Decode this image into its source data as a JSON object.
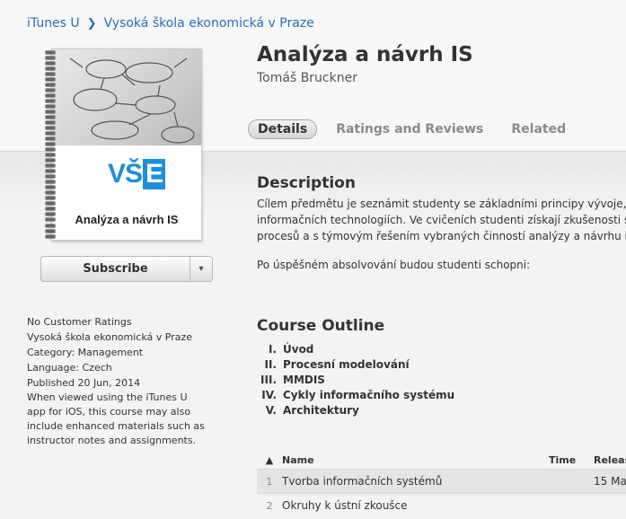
{
  "breadcrumb": {
    "items": [
      "iTunes U",
      "Vysoká škola ekonomická v Praze"
    ],
    "separator": "❯"
  },
  "artwork": {
    "logo_text": "VŠ",
    "logo_box": "E",
    "title": "Analýza a návrh IS"
  },
  "subscribe": {
    "label": "Subscribe",
    "dropdown_icon": "▾"
  },
  "side_info": {
    "ratings": "No Customer Ratings",
    "provider": "Vysoká škola ekonomická v Praze",
    "category": "Category: Management",
    "language": "Language: Czech",
    "published": "Published 20 Jun, 2014",
    "note": "When viewed using the iTunes U app for iOS, this course may also include enhanced materials such as instructor notes and assignments."
  },
  "course": {
    "title": "Analýza a návrh IS",
    "author": "Tomáš Bruckner"
  },
  "tabs": [
    "Details",
    "Ratings and Reviews",
    "Related"
  ],
  "description": {
    "heading": "Description",
    "line1": "Cílem předmětu je seznámit studenty se základními principy vývoje, pro",
    "line2": "informačních technologiích. Ve cvičeních studenti získají zkušenosti s mo",
    "line3": "procesů a s týmovým řešením vybraných činností analýzy a návrhu infor",
    "p2": "Po úspěšném absolvování budou studenti schopni:"
  },
  "outline": {
    "heading": "Course Outline",
    "items": [
      {
        "num": "I.",
        "label": "Úvod"
      },
      {
        "num": "II.",
        "label": "Procesní modelování"
      },
      {
        "num": "III.",
        "label": "MMDIS"
      },
      {
        "num": "IV.",
        "label": "Cykly informačního systému"
      },
      {
        "num": "V.",
        "label": "Architektury"
      }
    ]
  },
  "table": {
    "sort_icon": "▲",
    "columns": {
      "name": "Name",
      "time": "Time",
      "release": "Release"
    },
    "rows": [
      {
        "num": "1",
        "name": "Tvorba informačních systémů",
        "time": "",
        "release": "15 Ma"
      },
      {
        "num": "2",
        "name": "Okruhy k ústní zkoušce",
        "time": "",
        "release": ""
      }
    ]
  }
}
